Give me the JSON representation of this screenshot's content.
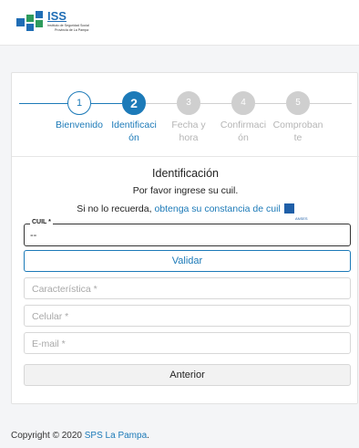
{
  "header": {
    "logo_title": "ISS",
    "logo_line1": "Instituto de Seguridad Social",
    "logo_line2": "Provincia de La Pampa"
  },
  "steps": [
    {
      "number": "1",
      "label_l1": "Bienvenido",
      "label_l2": "",
      "state": "done"
    },
    {
      "number": "2",
      "label_l1": "Identificaci",
      "label_l2": "ón",
      "state": "active"
    },
    {
      "number": "3",
      "label_l1": "Fecha y",
      "label_l2": "hora",
      "state": "pending"
    },
    {
      "number": "4",
      "label_l1": "Confirmaci",
      "label_l2": "ón",
      "state": "pending"
    },
    {
      "number": "5",
      "label_l1": "Comproban",
      "label_l2": "te",
      "state": "pending"
    }
  ],
  "form": {
    "title": "Identificación",
    "subtitle": "Por favor ingrese su cuil.",
    "hint_prefix": "Si no lo recuerda,",
    "hint_link": "obtenga su constancia de cuil",
    "anses_label": "ANSES",
    "cuil_label": "CUIL *",
    "cuil_value": "--",
    "validate_label": "Validar",
    "caracteristica_placeholder": "Característica *",
    "celular_placeholder": "Celular *",
    "email_placeholder": "E-mail *",
    "back_label": "Anterior"
  },
  "footer": {
    "copyright": "Copyright © 2020",
    "link": "SPS La Pampa",
    "suffix": "."
  },
  "colors": {
    "accent": "#1c7ab8",
    "pending": "#cfcfcf",
    "background": "#f4f5f7"
  }
}
